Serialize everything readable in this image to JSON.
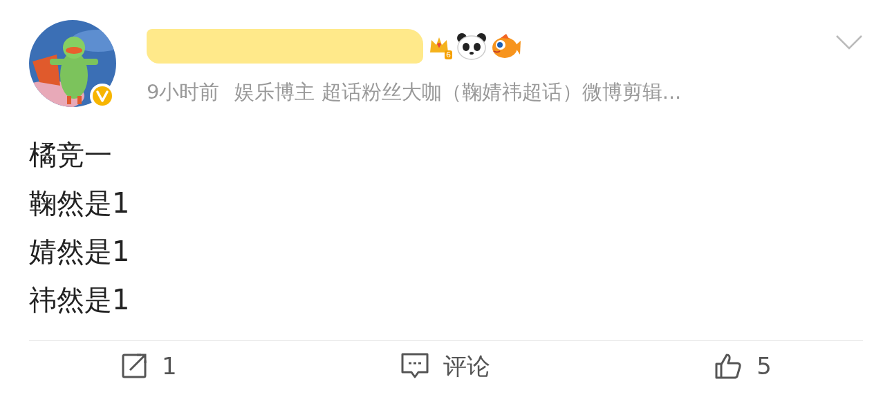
{
  "post": {
    "author": {
      "verified": true,
      "name_redacted": true,
      "badges": [
        {
          "kind": "crown",
          "label": "6"
        },
        {
          "kind": "panda"
        },
        {
          "kind": "fish"
        }
      ]
    },
    "time": "9小时前",
    "meta": "娱乐博主 超话粉丝大咖（鞠婧祎超话）微博剪辑...",
    "lines": [
      "橘竞一",
      "鞠然是1",
      "婧然是1",
      "祎然是1"
    ],
    "actions": [
      {
        "kind": "repost",
        "label": "1"
      },
      {
        "kind": "comment",
        "label": "评论"
      },
      {
        "kind": "like",
        "label": "5"
      }
    ]
  }
}
